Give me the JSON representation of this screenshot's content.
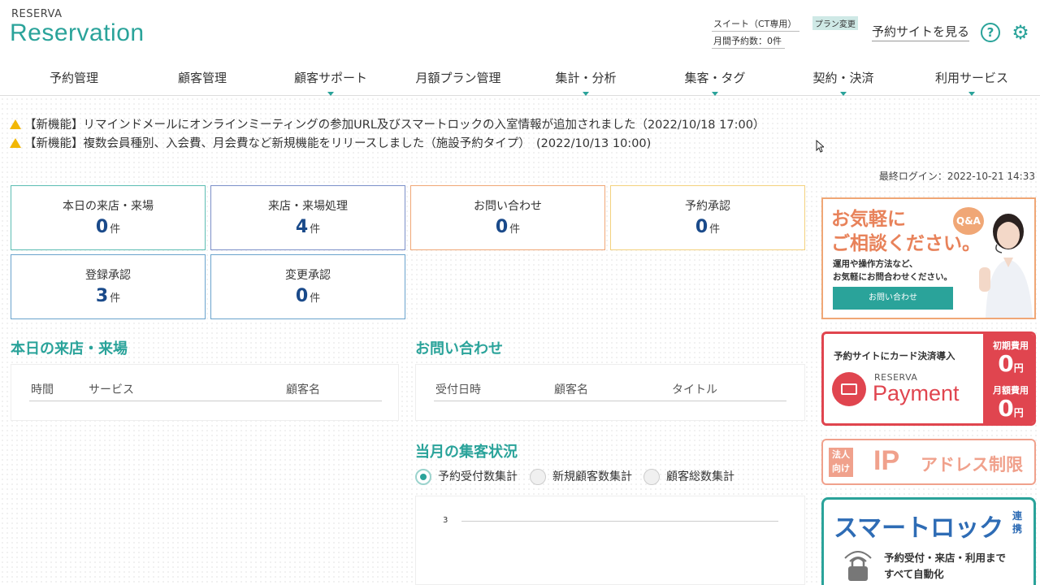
{
  "header": {
    "logo_small": "RESERVA",
    "logo_big": "Reservation",
    "plan_name": "スイート（CT専用）",
    "plan_change": "プラン変更",
    "monthly_count": "月間予約数：0件",
    "site_link": "予約サイトを見る",
    "help_icon": "?",
    "gear_icon": "⚙"
  },
  "nav": [
    {
      "label": "予約管理",
      "has_menu": false
    },
    {
      "label": "顧客管理",
      "has_menu": false
    },
    {
      "label": "顧客サポート",
      "has_menu": true
    },
    {
      "label": "月額プラン管理",
      "has_menu": false
    },
    {
      "label": "集計・分析",
      "has_menu": true
    },
    {
      "label": "集客・タグ",
      "has_menu": true
    },
    {
      "label": "契約・決済",
      "has_menu": true
    },
    {
      "label": "利用サービス",
      "has_menu": true
    }
  ],
  "notices": [
    "【新機能】リマインドメールにオンラインミーティングの参加URL及びスマートロックの入室情報が追加されました（2022/10/18 17:00）",
    "【新機能】複数会員種別、入会費、月会費など新規機能をリリースしました（施設予約タイプ）　(2022/10/13 10:00)"
  ],
  "last_login": "最終ログイン：2022-10-21 14:33",
  "stats": [
    {
      "label": "本日の来店・来場",
      "value": "0",
      "unit": "件",
      "color": "#5cbdb3"
    },
    {
      "label": "来店・来場処理",
      "value": "4",
      "unit": "件",
      "color": "#7b8fc8"
    },
    {
      "label": "お問い合わせ",
      "value": "0",
      "unit": "件",
      "color": "#f0a776"
    },
    {
      "label": "予約承認",
      "value": "0",
      "unit": "件",
      "color": "#f3d17e"
    },
    {
      "label": "登録承認",
      "value": "3",
      "unit": "件",
      "color": "#6aa3cc"
    },
    {
      "label": "変更承認",
      "value": "0",
      "unit": "件",
      "color": "#6aa3cc"
    }
  ],
  "visits_section": {
    "title": "本日の来店・来場",
    "headers": [
      "時間",
      "サービス",
      "顧客名"
    ]
  },
  "inquiry_section": {
    "title": "お問い合わせ",
    "headers": [
      "受付日時",
      "顧客名",
      "タイトル"
    ]
  },
  "stats_section": {
    "title": "当月の集客状況",
    "radios": [
      {
        "label": "予約受付数集計",
        "checked": true
      },
      {
        "label": "新規顧客数集計",
        "checked": false
      },
      {
        "label": "顧客総数集計",
        "checked": false
      }
    ],
    "y_tick": "3"
  },
  "ads": {
    "qa": {
      "line1": "お気軽に",
      "line2": "ご相談ください。",
      "badge": "Q&A",
      "desc1": "運用や操作方法など、",
      "desc2": "お気軽にお問合わせください。",
      "button": "お問い合わせ"
    },
    "payment": {
      "headline": "予約サイトにカード決済導入",
      "brand_small": "RESERVA",
      "brand_big": "Payment",
      "fee1_label": "初期費用",
      "fee1_value": "0",
      "fee1_unit": "円",
      "fee2_label": "月額費用",
      "fee2_value": "0",
      "fee2_unit": "円"
    },
    "ip": {
      "tag1": "法人",
      "tag2": "向け",
      "big": "IP",
      "rest": "アドレス制限"
    },
    "smartlock": {
      "title": "スマートロック",
      "side1": "連",
      "side2": "携",
      "desc1": "予約受付・来店・利用まで",
      "desc2": "すべて自動化"
    }
  }
}
